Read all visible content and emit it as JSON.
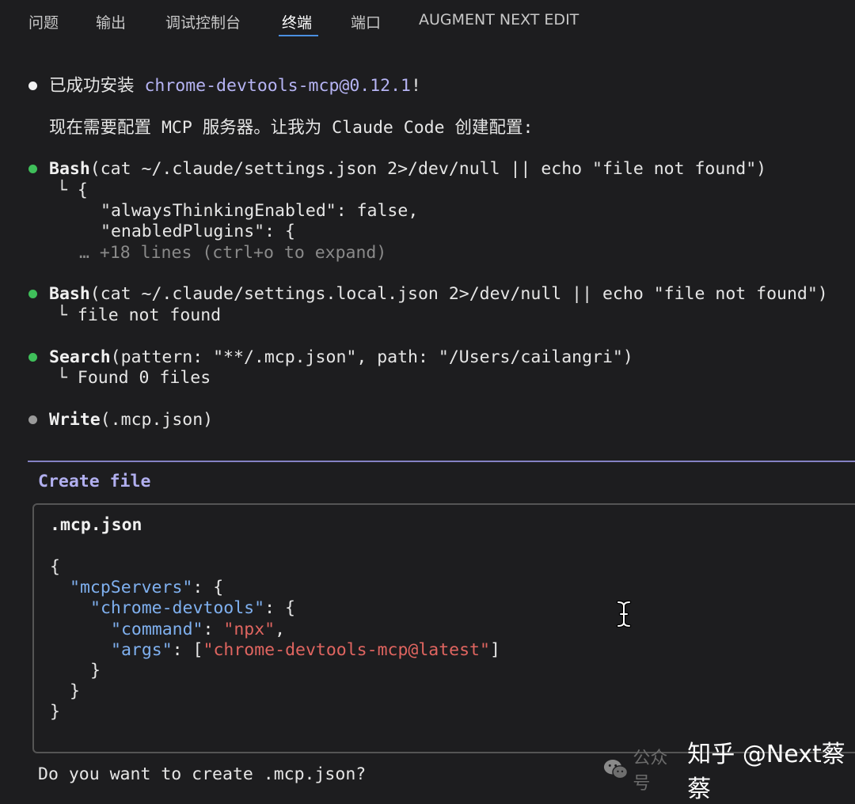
{
  "tabs": [
    {
      "label": "问题"
    },
    {
      "label": "输出"
    },
    {
      "label": "调试控制台"
    },
    {
      "label": "终端",
      "active": true
    },
    {
      "label": "端口"
    },
    {
      "label": "AUGMENT NEXT EDIT"
    }
  ],
  "accent_color": "#4a8fe0",
  "terminal": {
    "install": {
      "prefix": "已成功安装 ",
      "package": "chrome-devtools-mcp@0.12.1",
      "suffix": "!"
    },
    "intro": "现在需要配置 MCP 服务器。让我为 Claude Code 创建配置:",
    "bash1": {
      "tool": "Bash",
      "args": "(cat ~/.claude/settings.json 2>/dev/null || echo \"file not found\")",
      "out1": "└ {",
      "out2": "\"alwaysThinkingEnabled\": false,",
      "out3": "\"enabledPlugins\": {",
      "more": "… +18 lines (ctrl+o to expand)"
    },
    "bash2": {
      "tool": "Bash",
      "args": "(cat ~/.claude/settings.local.json 2>/dev/null || echo \"file not found\")",
      "out": "└ file not found"
    },
    "search": {
      "tool": "Search",
      "args": "(pattern: \"**/.mcp.json\", path: \"/Users/cailangri\")",
      "out": "└ Found 0 files"
    },
    "write": {
      "tool": "Write",
      "args": "(.mcp.json)"
    }
  },
  "create_file": {
    "title": "Create file",
    "filename": ".mcp.json",
    "json": {
      "k_servers": "\"mcpServers\"",
      "k_devtools": "\"chrome-devtools\"",
      "k_command": "\"command\"",
      "v_command": "\"npx\"",
      "k_args": "\"args\"",
      "v_args": "\"chrome-devtools-mcp@latest\""
    },
    "prompt": "Do you want to create .mcp.json?"
  },
  "watermark": {
    "faint": "公众号",
    "text": "知乎 @Next蔡蔡"
  },
  "icons": [
    "text-cursor-icon",
    "wechat-icon"
  ]
}
